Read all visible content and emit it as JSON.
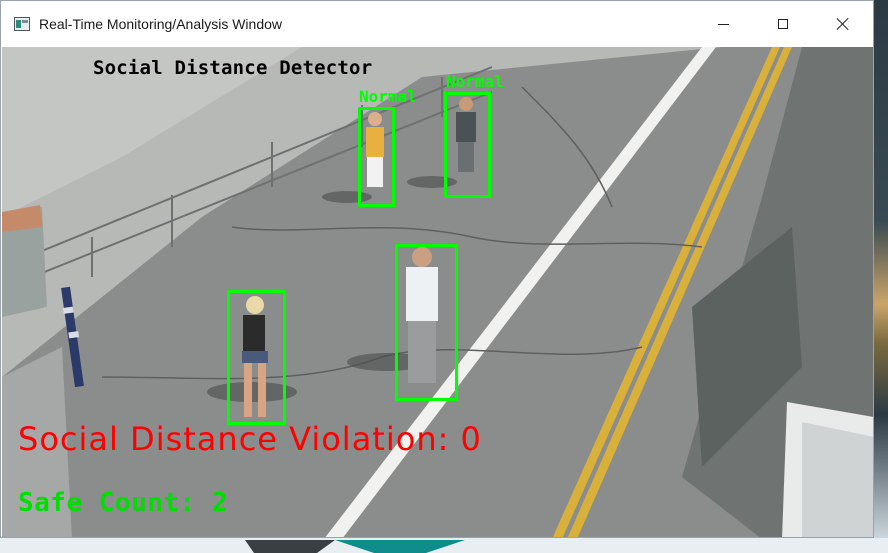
{
  "window": {
    "title": "Real-Time Monitoring/Analysis Window"
  },
  "video": {
    "overlay_title": "Social Distance Detector",
    "violation_text": "Social Distance Violation: 0",
    "safe_count_text": "Safe Count: 2",
    "colors": {
      "box": "#00ff00",
      "violation": "#ff0000",
      "safe": "#00dd00",
      "title": "#000000"
    },
    "detections": [
      {
        "label": "Normal"
      },
      {
        "label": "Normal"
      },
      {
        "label": ""
      },
      {
        "label": ""
      }
    ]
  },
  "icons": {
    "app": "app-window-icon",
    "minimize": "minimize-icon",
    "maximize": "maximize-icon",
    "close": "close-icon"
  }
}
